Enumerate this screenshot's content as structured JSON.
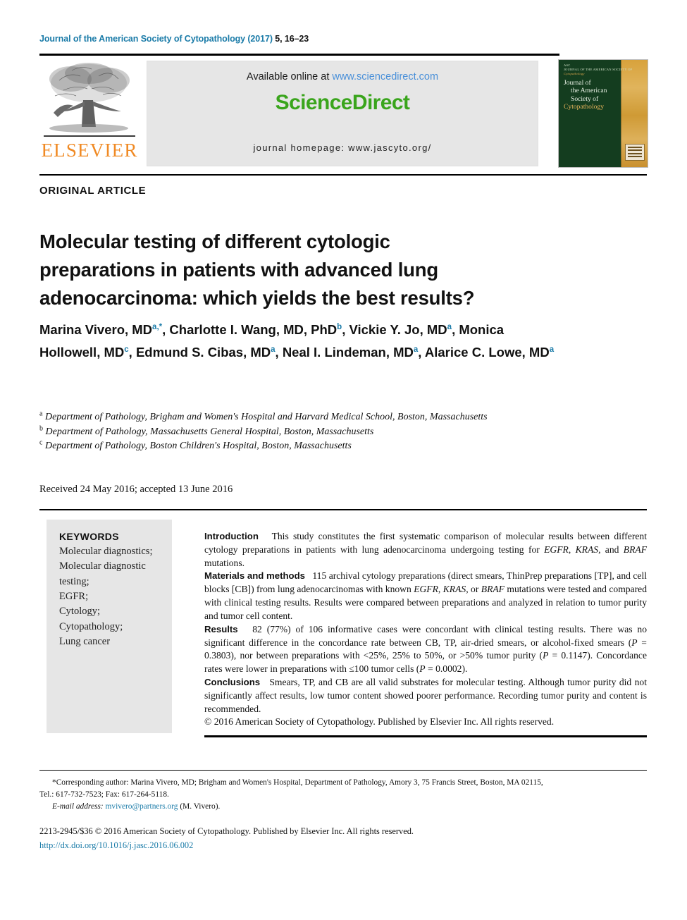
{
  "running_head": {
    "journal": "Journal of the American Society of Cytopathology (2017) ",
    "volume_pages": "5, 16–23"
  },
  "masthead": {
    "publisher_name": "ELSEVIER",
    "available_online_prefix": "Available online at ",
    "sciencedirect_url": "www.sciencedirect.com",
    "sciencedirect_logo": "ScienceDirect",
    "journal_homepage": "journal homepage: www.jascyto.org/",
    "cover": {
      "top_label_line1": "ASC",
      "top_label_line2": "JOURNAL OF THE AMERICAN SOCIETY OF",
      "top_label_line3": "Cytopathology",
      "title_line1": "Journal of",
      "title_line2": "the American",
      "title_line3": "Society of",
      "title_line4": "Cytopathology"
    }
  },
  "article": {
    "type": "ORIGINAL ARTICLE",
    "title": "Molecular testing of different cytologic preparations in patients with advanced lung adenocarcinoma: which yields the best results?",
    "authors": [
      {
        "name": "Marina Vivero, MD",
        "marks": "a,*",
        "sep": ", "
      },
      {
        "name": "Charlotte I. Wang, MD, PhD",
        "marks": "b",
        "sep": ", "
      },
      {
        "name": "Vickie Y. Jo, MD",
        "marks": "a",
        "sep": ", "
      },
      {
        "name": "Monica Hollowell, MD",
        "marks": "c",
        "sep": ", "
      },
      {
        "name": "Edmund S. Cibas, MD",
        "marks": "a",
        "sep": ", "
      },
      {
        "name": "Neal I. Lindeman, MD",
        "marks": "a",
        "sep": ", "
      },
      {
        "name": "Alarice C. Lowe, MD",
        "marks": "a",
        "sep": ""
      }
    ],
    "affiliations": [
      {
        "mark": "a",
        "text": "Department of Pathology, Brigham and Women's Hospital and Harvard Medical School, Boston, Massachusetts"
      },
      {
        "mark": "b",
        "text": "Department of Pathology, Massachusetts General Hospital, Boston, Massachusetts"
      },
      {
        "mark": "c",
        "text": "Department of Pathology, Boston Children's Hospital, Boston, Massachusetts"
      }
    ],
    "history": "Received 24 May 2016; accepted 13 June 2016"
  },
  "keywords": {
    "heading": "KEYWORDS",
    "items": [
      "Molecular diagnostics;",
      "Molecular diagnostic",
      "testing;",
      "EGFR;",
      "Cytology;",
      "Cytopathology;",
      "Lung cancer"
    ]
  },
  "abstract": {
    "sections": [
      {
        "heading": "Introduction",
        "body": "This study constitutes the first systematic comparison of molecular results between different cytology preparations in patients with lung adenocarcinoma undergoing testing for EGFR, KRAS, and BRAF mutations."
      },
      {
        "heading": "Materials and methods",
        "body": "115 archival cytology preparations (direct smears, ThinPrep preparations [TP], and cell blocks [CB]) from lung adenocarcinomas with known EGFR, KRAS, or BRAF mutations were tested and compared with clinical testing results. Results were compared between preparations and analyzed in relation to tumor purity and tumor cell content."
      },
      {
        "heading": "Results",
        "body": "82 (77%) of 106 informative cases were concordant with clinical testing results. There was no significant difference in the concordance rate between CB, TP, air-dried smears, or alcohol-fixed smears (P = 0.3803), nor between preparations with <25%, 25% to 50%, or >50% tumor purity (P = 0.1147). Concordance rates were lower in preparations with ≤100 tumor cells (P = 0.0002)."
      },
      {
        "heading": "Conclusions",
        "body": "Smears, TP, and CB are all valid substrates for molecular testing. Although tumor purity did not significantly affect results, low tumor content showed poorer performance. Recording tumor purity and content is recommended."
      }
    ],
    "rights": "© 2016 American Society of Cytopathology. Published by Elsevier Inc. All rights reserved."
  },
  "footer": {
    "corresponding_line1": "*Corresponding author: Marina Vivero, MD; Brigham and Women's Hospital, Department of Pathology, Amory 3, 75 Francis Street, Boston, MA 02115,",
    "corresponding_line2": "Tel.: 617-732-7523; Fax: 617-264-5118.",
    "email_label": "E-mail address:",
    "email": "mvivero@partners.org",
    "email_suffix": "(M. Vivero).",
    "issn_copyright": "2213-2945/$36 © 2016 American Society of Cytopathology. Published by Elsevier Inc. All rights reserved.",
    "doi": "http://dx.doi.org/10.1016/j.jasc.2016.06.002"
  },
  "colors": {
    "link_blue": "#1a7ba8",
    "sciencedirect_green": "#3aa51c",
    "sciencedirect_link": "#4a90d9",
    "elsevier_orange": "#f08a24",
    "panel_gray": "#e6e6e6"
  }
}
